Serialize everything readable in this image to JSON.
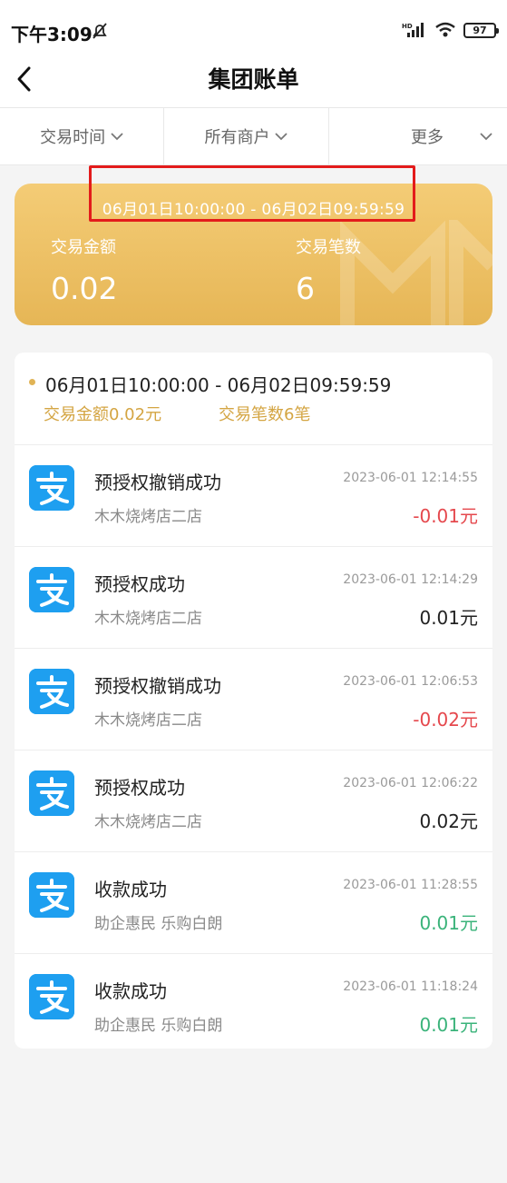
{
  "status_bar": {
    "time": "下午3:09",
    "network": "HD",
    "battery": "97"
  },
  "header": {
    "title": "集团账单"
  },
  "filters": [
    {
      "label": "交易时间"
    },
    {
      "label": "所有商户"
    },
    {
      "label": "更多"
    }
  ],
  "summary": {
    "range": "06月01日10:00:00 - 06月02日09:59:59",
    "amount_label": "交易金额",
    "amount_value": "0.02",
    "count_label": "交易笔数",
    "count_value": "6"
  },
  "list_header": {
    "range": "06月01日10:00:00 - 06月02日09:59:59",
    "amount_text": "交易金额0.02元",
    "count_text": "交易笔数6笔"
  },
  "transactions": [
    {
      "title": "预授权撤销成功",
      "merchant": "木木烧烤店二店",
      "time": "2023-06-01 12:14:55",
      "amount": "-0.01元",
      "tone": "negative"
    },
    {
      "title": "预授权成功",
      "merchant": "木木烧烤店二店",
      "time": "2023-06-01 12:14:29",
      "amount": "0.01元",
      "tone": "neutral"
    },
    {
      "title": "预授权撤销成功",
      "merchant": "木木烧烤店二店",
      "time": "2023-06-01 12:06:53",
      "amount": "-0.02元",
      "tone": "negative"
    },
    {
      "title": "预授权成功",
      "merchant": "木木烧烤店二店",
      "time": "2023-06-01 12:06:22",
      "amount": "0.02元",
      "tone": "neutral"
    },
    {
      "title": "收款成功",
      "merchant": "助企惠民 乐购白朗",
      "time": "2023-06-01 11:28:55",
      "amount": "0.01元",
      "tone": "positive"
    },
    {
      "title": "收款成功",
      "merchant": "助企惠民 乐购白朗",
      "time": "2023-06-01 11:18:24",
      "amount": "0.01元",
      "tone": "positive"
    }
  ],
  "colors": {
    "accent_gold": "#e6b656",
    "negative": "#e5484d",
    "positive": "#3ab37a",
    "alipay_blue": "#1e9ff0",
    "highlight_red": "#e31b1b"
  }
}
